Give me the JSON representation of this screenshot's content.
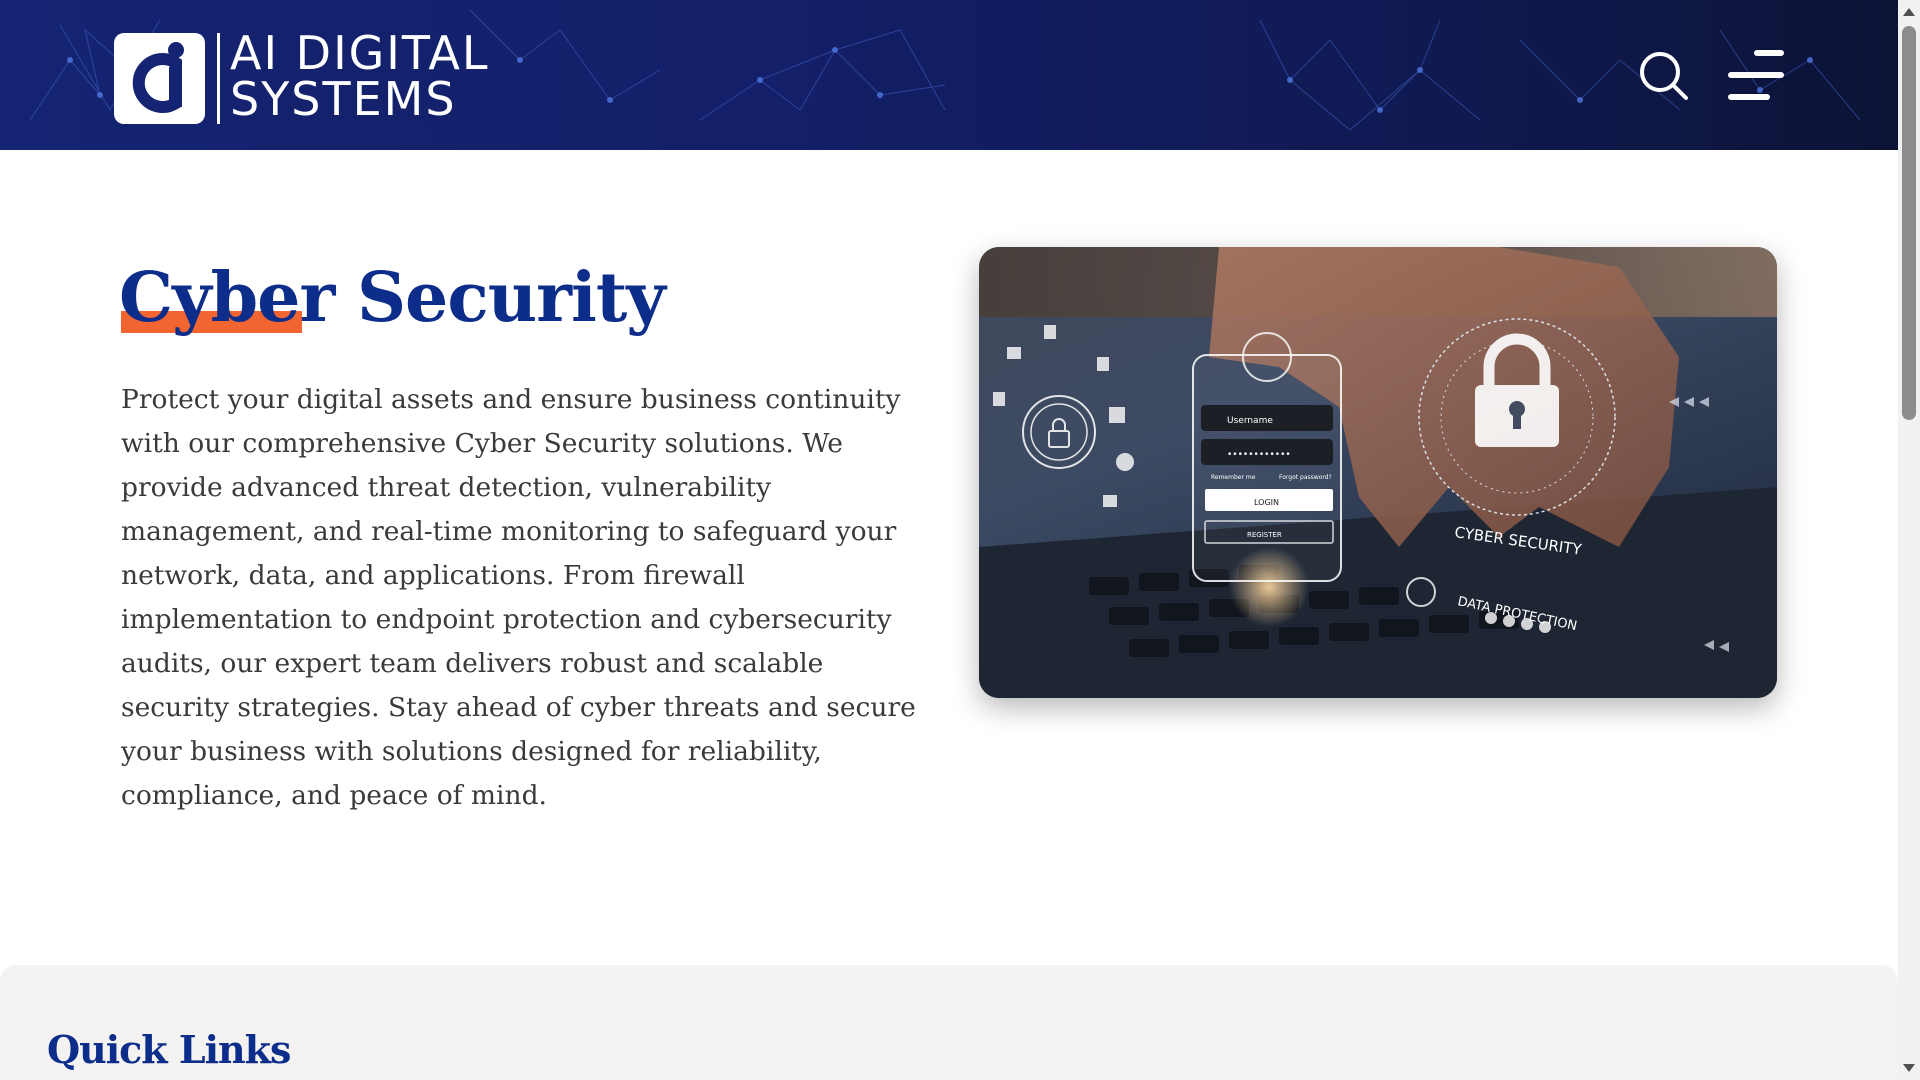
{
  "brand": {
    "line1": "AI DIGITAL",
    "line2": "SYSTEMS",
    "logo_icon": "ai-logo-icon",
    "header_color": "#142472"
  },
  "header": {
    "search_icon": "search-icon",
    "menu_icon": "hamburger-menu-icon"
  },
  "main": {
    "title": "Cyber Security",
    "accent_color": "#f26531",
    "title_color": "#0d2d8b",
    "description": "Protect your digital assets and ensure business continuity with our comprehensive Cyber Security solutions. We provide advanced threat detection, vulnerability management, and real-time monitoring to safeguard your network, data, and applications. From firewall implementation to endpoint protection and cybersecurity audits, our expert team delivers robust and scalable security strategies. Stay ahead of cyber threats and secure your business with solutions designed for reliability, compliance, and peace of mind.",
    "image": {
      "username_label": "Username",
      "password_mask": "••••••••••••",
      "remember_label": "Remember me",
      "forgot_label": "Forgot password?",
      "login_label": "LOGIN",
      "register_label": "REGISTER",
      "cyber_label": "CYBER SECURITY",
      "data_label": "DATA PROTECTION"
    }
  },
  "footer": {
    "title": "Quick Links"
  }
}
